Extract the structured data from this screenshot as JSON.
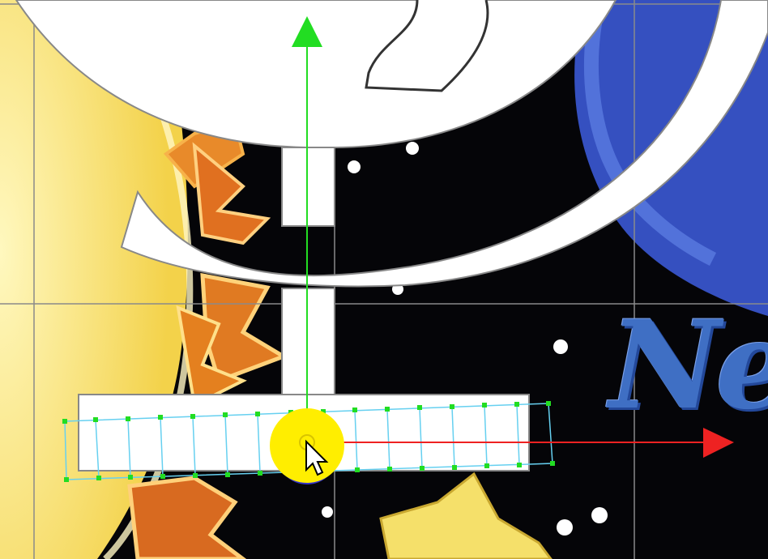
{
  "canvas": {
    "background_color": "#050508",
    "sun_color": "#f7e27a",
    "planet_color": "#3a56c8",
    "star_color": "#f5e06a",
    "shape_fill": "#ffffff",
    "grid_color": "#8a8a8a"
  },
  "artwork_text": {
    "title_fragment": "Ne",
    "title_color": "#3f6fc4"
  },
  "gizmo": {
    "y_axis_color": "#22dd22",
    "x_axis_color": "#ee2222",
    "pivot_color": "#ffee00",
    "pivot_back_color": "#3333cc",
    "mesh_outline_color": "#66d0f0",
    "vertex_color": "#22dd22",
    "y_axis_icon": "arrow-up-icon",
    "x_axis_icon": "arrow-right-icon",
    "cursor_icon": "mouse-pointer-icon"
  }
}
